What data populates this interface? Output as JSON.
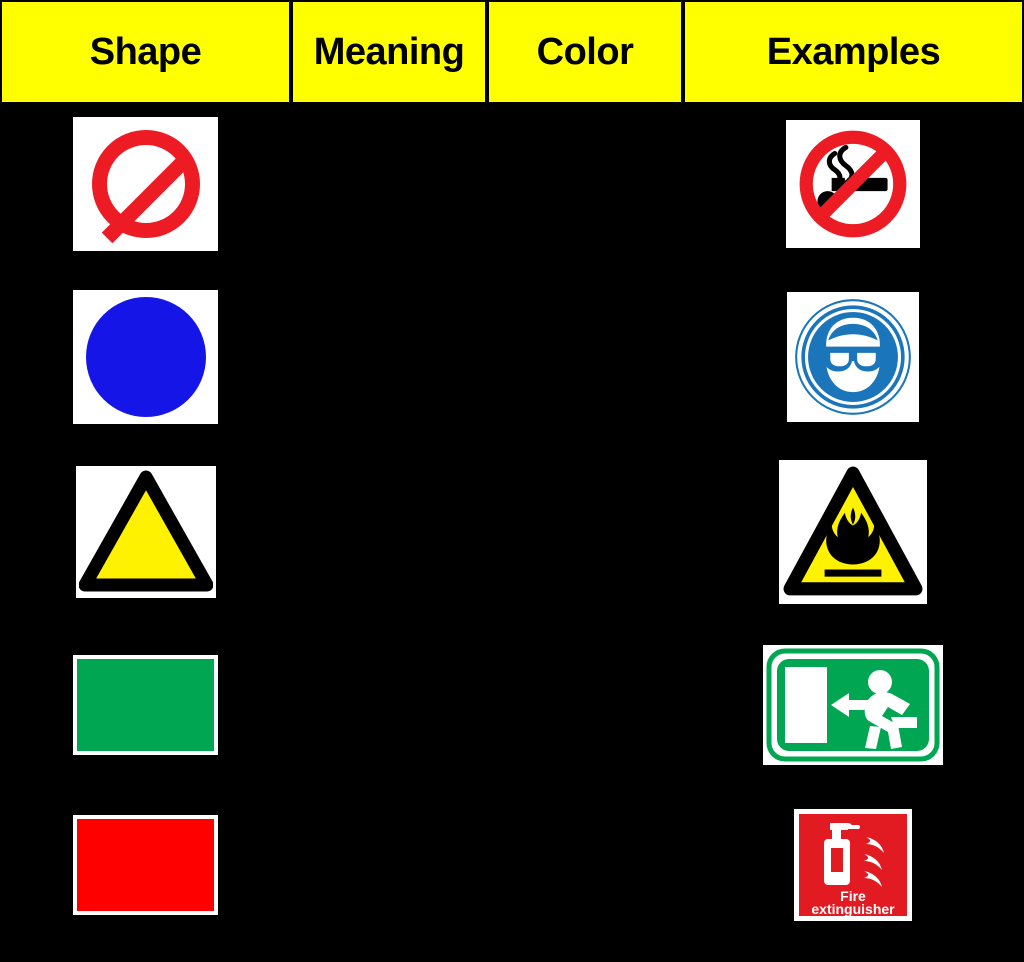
{
  "table": {
    "headers": [
      {
        "key": "shape",
        "label": "Shape"
      },
      {
        "key": "meaning",
        "label": "Meaning"
      },
      {
        "key": "color",
        "label": "Color"
      },
      {
        "key": "examples",
        "label": "Examples"
      }
    ],
    "header_background": "#FFFF00",
    "header_text_color": "#000000",
    "page_background": "#000000",
    "rows": [
      {
        "shape_icon": "prohibition-circle-icon",
        "shape_description": "Red circle with diagonal slash",
        "shape_colors": {
          "stroke": "#ED1C24",
          "fill": "#FFFFFF"
        },
        "meaning": "",
        "color": "",
        "example_icon": "no-smoking-sign-icon",
        "example_description": "No smoking sign",
        "example_label": ""
      },
      {
        "shape_icon": "blue-circle-icon",
        "shape_description": "Solid blue circle",
        "shape_colors": {
          "fill": "#1515E8"
        },
        "meaning": "",
        "color": "",
        "example_icon": "eye-protection-sign-icon",
        "example_description": "Wear eye protection sign",
        "example_label": ""
      },
      {
        "shape_icon": "yellow-triangle-icon",
        "shape_description": "Yellow triangle with black border",
        "shape_colors": {
          "fill": "#FFF200",
          "stroke": "#000000"
        },
        "meaning": "",
        "color": "",
        "example_icon": "flammable-warning-sign-icon",
        "example_description": "Flammable material warning triangle",
        "example_label": ""
      },
      {
        "shape_icon": "green-rectangle-icon",
        "shape_description": "Green rectangle",
        "shape_colors": {
          "fill": "#00A651"
        },
        "meaning": "",
        "color": "",
        "example_icon": "emergency-exit-sign-icon",
        "example_description": "Emergency exit running man sign",
        "example_label": ""
      },
      {
        "shape_icon": "red-rectangle-icon",
        "shape_description": "Red rectangle",
        "shape_colors": {
          "fill": "#FF0000"
        },
        "meaning": "",
        "color": "",
        "example_icon": "fire-extinguisher-sign-icon",
        "example_description": "Fire extinguisher sign",
        "example_label": "Fire\nextinguisher",
        "example_label_line1": "Fire",
        "example_label_line2": "extinguisher"
      }
    ]
  }
}
